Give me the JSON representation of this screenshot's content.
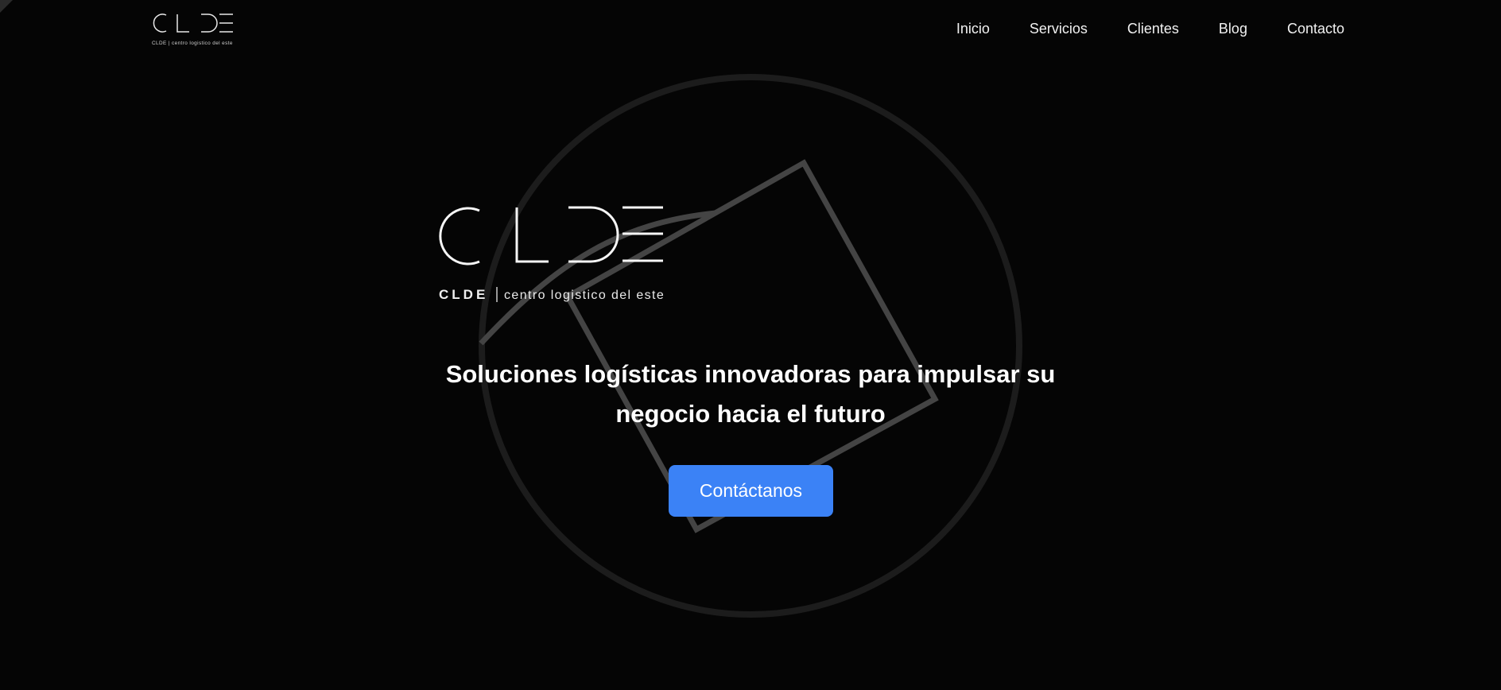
{
  "brand": {
    "mark": "CLDE",
    "tagline_small": "CLDE | centro logistico del este",
    "tagline_large_left": "CLDE",
    "tagline_large_right": "centro logistico del este"
  },
  "nav": {
    "items": [
      "Inicio",
      "Servicios",
      "Clientes",
      "Blog",
      "Contacto"
    ]
  },
  "hero": {
    "headline": "Soluciones logísticas innovadoras para impulsar su negocio hacia el futuro",
    "cta_label": "Contáctanos"
  },
  "colors": {
    "background": "#050505",
    "accent": "#3b82f6",
    "circle": "#1c1c1c",
    "diamond": "#444444",
    "text": "#ffffff"
  }
}
